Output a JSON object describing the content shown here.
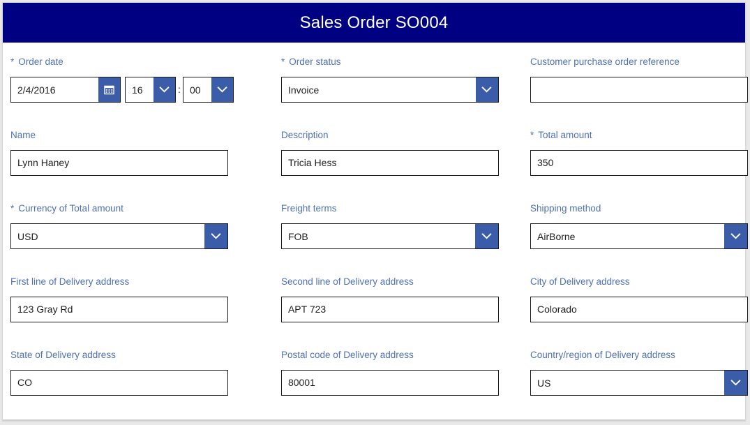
{
  "window": {
    "title": "Sales Order SO004",
    "header_bg": "#000082",
    "accent": "#3b5ca8",
    "label_color": "#4e70b5"
  },
  "rows": [
    {
      "fields": [
        {
          "label": "Order date",
          "required": true,
          "required_mark": "*",
          "type": "datetime",
          "date_value": "2/4/2016",
          "date_placeholder": "",
          "calendar_icon": "calendar-icon",
          "hour_value": "16",
          "separator": ":",
          "minute_value": "00"
        },
        {
          "label": "Order status",
          "required": true,
          "required_mark": "*",
          "type": "combo",
          "value": "Invoice",
          "icon": "chevron-down-icon"
        },
        {
          "label": "Customer purchase order reference",
          "required": false,
          "required_mark": "",
          "type": "text",
          "value": "",
          "placeholder": ""
        }
      ]
    },
    {
      "fields": [
        {
          "label": "Name",
          "required": false,
          "required_mark": "",
          "type": "text",
          "value": "Lynn Haney",
          "placeholder": ""
        },
        {
          "label": "Description",
          "required": false,
          "required_mark": "",
          "type": "text",
          "value": "Tricia Hess",
          "placeholder": ""
        },
        {
          "label": "Total amount",
          "required": true,
          "required_mark": "*",
          "type": "text",
          "value": "350",
          "placeholder": ""
        }
      ]
    },
    {
      "fields": [
        {
          "label": "Currency of Total amount",
          "required": true,
          "required_mark": "*",
          "type": "combo",
          "value": "USD",
          "icon": "chevron-down-icon"
        },
        {
          "label": "Freight terms",
          "required": false,
          "required_mark": "",
          "type": "combo",
          "value": "FOB",
          "icon": "chevron-down-icon"
        },
        {
          "label": "Shipping method",
          "required": false,
          "required_mark": "",
          "type": "combo",
          "value": "AirBorne",
          "icon": "chevron-down-icon"
        }
      ]
    },
    {
      "fields": [
        {
          "label": "First line of Delivery address",
          "required": false,
          "required_mark": "",
          "type": "text",
          "value": "123 Gray Rd",
          "placeholder": ""
        },
        {
          "label": "Second line of Delivery address",
          "required": false,
          "required_mark": "",
          "type": "text",
          "value": "APT 723",
          "placeholder": ""
        },
        {
          "label": "City of Delivery address",
          "required": false,
          "required_mark": "",
          "type": "text",
          "value": "Colorado",
          "placeholder": ""
        }
      ]
    },
    {
      "fields": [
        {
          "label": "State of Delivery address",
          "required": false,
          "required_mark": "",
          "type": "text",
          "value": "CO",
          "placeholder": ""
        },
        {
          "label": "Postal code of Delivery address",
          "required": false,
          "required_mark": "",
          "type": "text",
          "value": "80001",
          "placeholder": ""
        },
        {
          "label": "Country/region of Delivery address",
          "required": false,
          "required_mark": "",
          "type": "combo",
          "value": "US",
          "icon": "chevron-down-icon"
        }
      ]
    }
  ]
}
